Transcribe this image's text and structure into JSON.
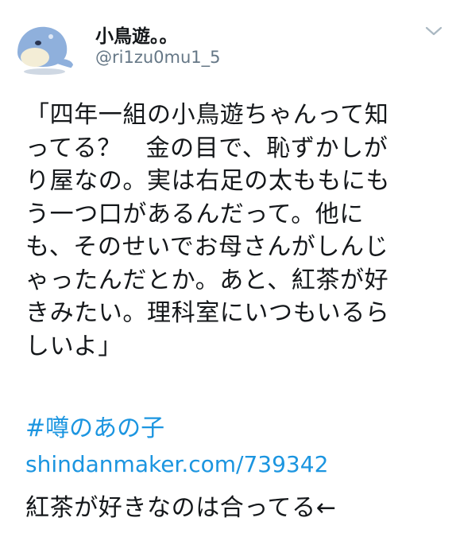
{
  "tweet": {
    "author": {
      "display_name": "小鳥遊。。",
      "handle": "@ri1zu0mu1_5",
      "avatar_icon": "avatar-image-icon",
      "avatar_signature": "Takanashi"
    },
    "menu_icon": "chevron-down-icon",
    "text_lines": [
      "「四年一組の小鳥遊ちゃんって知",
      "ってる？　金の目で、恥ずかしが",
      "り屋なの。実は右足の太ももにも",
      "う一つ口があるんだって。他に",
      "も、そのせいでお母さんがしんじ",
      "ゃったんだとか。あと、紅茶が好",
      "きみたい。理科室にいつもいるら",
      "しいよ」"
    ],
    "hashtag": "#噂のあの子",
    "link": "shindanmaker.com/739342",
    "comment": "紅茶が好きなのは合ってる←"
  },
  "colors": {
    "text": "#14171a",
    "secondary": "#657786",
    "link": "#1b95e0",
    "avatar_creature": "#8fb0dc"
  }
}
